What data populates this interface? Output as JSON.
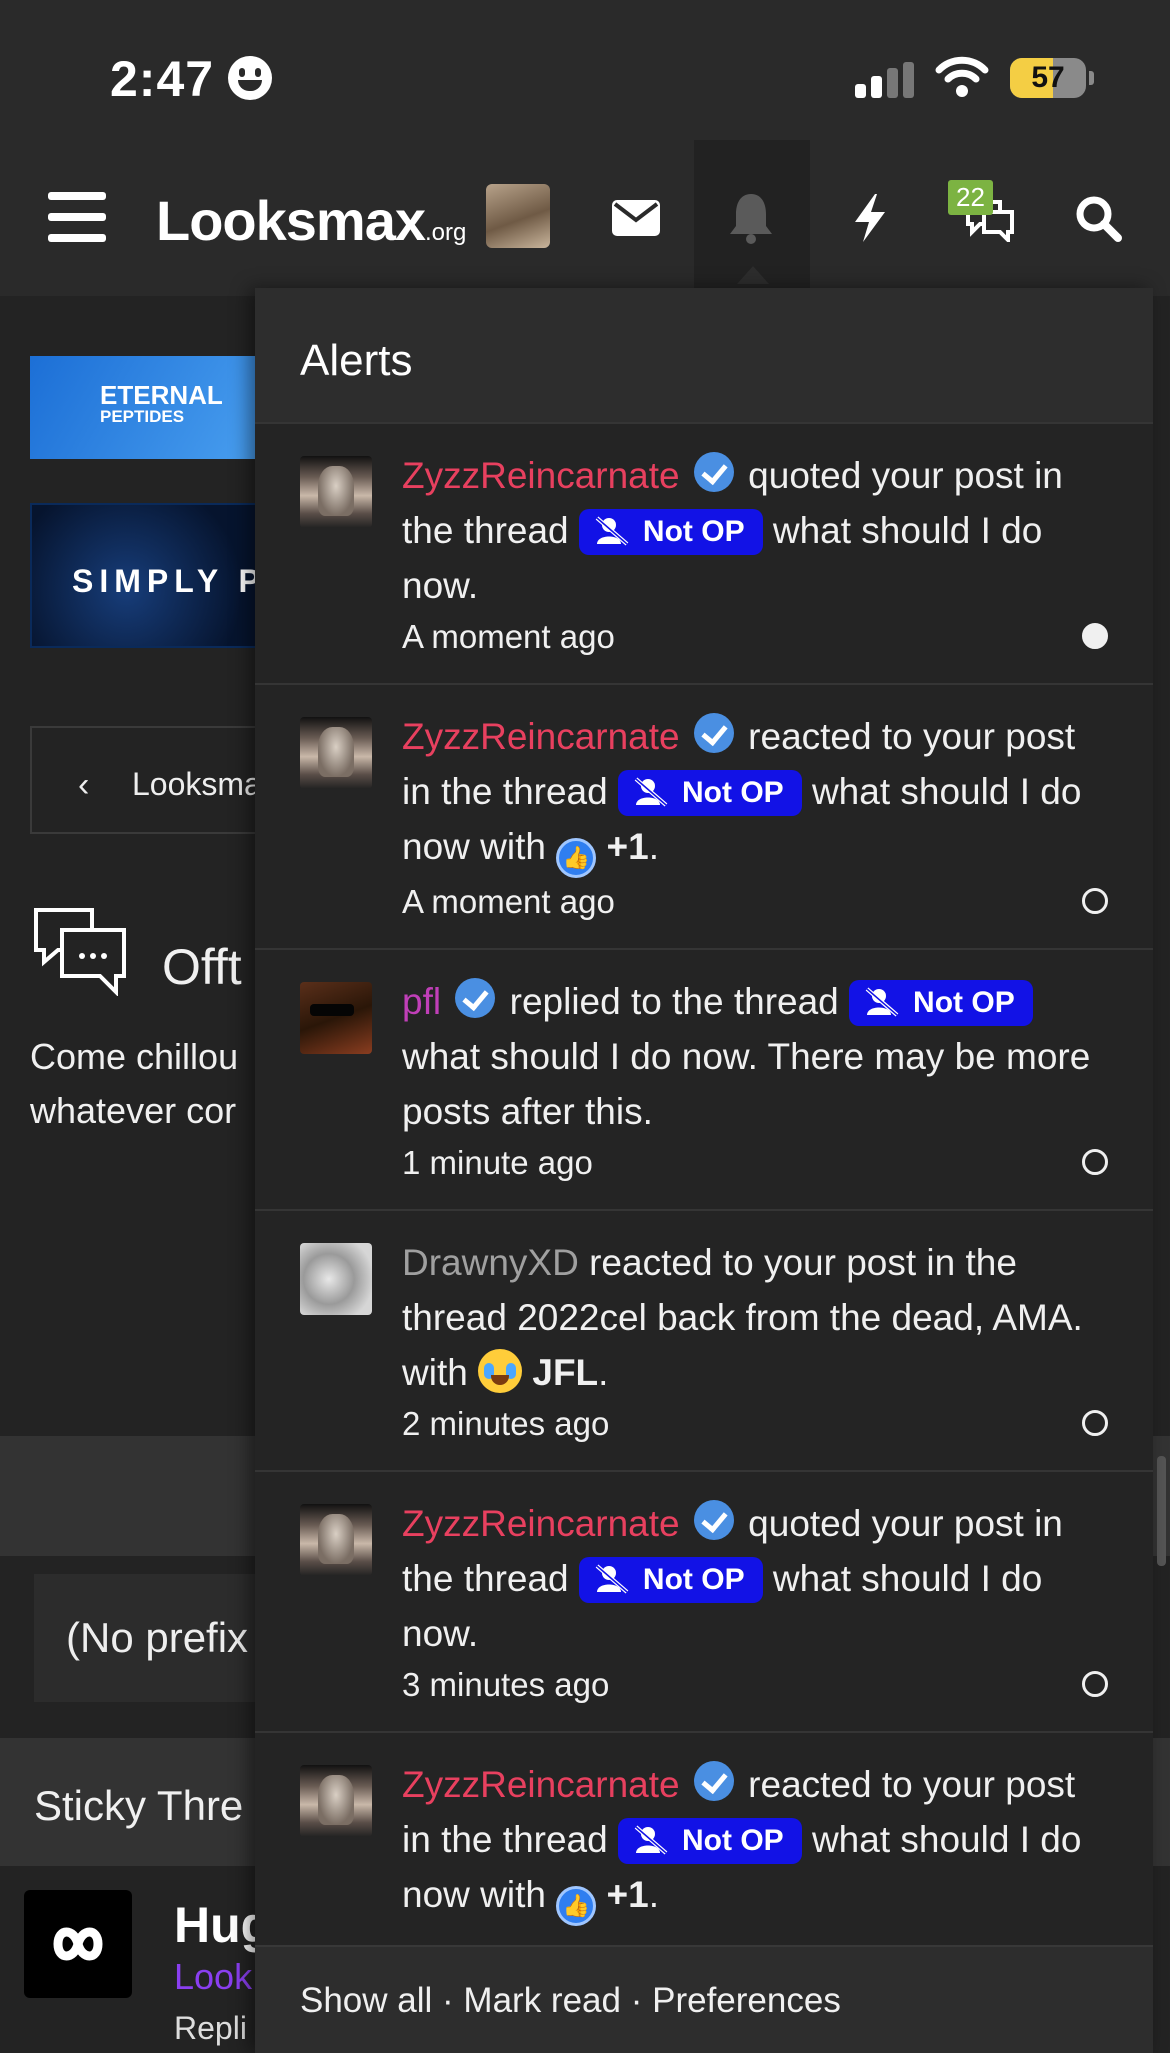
{
  "status_bar": {
    "time": "2:47",
    "battery": "57",
    "battery_level": 0.57
  },
  "nav": {
    "logo_main": "Looksmax",
    "logo_suffix": ".org",
    "conversations_count": "22",
    "icons": [
      "menu-icon",
      "avatar",
      "envelope-icon",
      "bell-icon",
      "bolt-icon",
      "chat-bubbles-icon",
      "search-icon"
    ]
  },
  "background_page": {
    "ad1_title": "ETERNAL",
    "ad1_sub": "PEPTIDES",
    "ad2_title": "SIMPLY P",
    "breadcrumb": "Looksma",
    "forum_title": "Offt",
    "forum_desc": "Come chillou\nwhatever cor",
    "prefix_filter": "(No prefix",
    "sticky_label": "Sticky Thre",
    "thread_title": "Hug",
    "thread_category": "Look",
    "thread_replies": "Repli"
  },
  "alerts_popup": {
    "title": "Alerts",
    "tag_label": "Not OP",
    "alerts": [
      {
        "user": "ZyzzReincarnate",
        "verified": true,
        "action": "quoted your post in the thread",
        "thread": "what should I do now.",
        "time": "A moment ago",
        "unread": true
      },
      {
        "user": "ZyzzReincarnate",
        "verified": true,
        "action": "reacted to your post in the thread",
        "thread": "what should I do now with",
        "reaction": "+1",
        "time": "A moment ago",
        "unread": false
      },
      {
        "user": "pfl",
        "verified": true,
        "action": "replied to the thread",
        "thread": "what should I do now. There may be more posts after this.",
        "time": "1 minute ago",
        "unread": false
      },
      {
        "user": "DrawnyXD",
        "verified": false,
        "action": "reacted to your post in the thread 2022cel back from the dead, AMA. with",
        "reaction": "JFL",
        "time": "2 minutes ago",
        "unread": false
      },
      {
        "user": "ZyzzReincarnate",
        "verified": true,
        "action": "quoted your post in the thread",
        "thread": "what should I do now.",
        "time": "3 minutes ago",
        "unread": false
      },
      {
        "user": "ZyzzReincarnate",
        "verified": true,
        "action": "reacted to your post in the thread",
        "thread": "what should I do now with",
        "reaction": "+1",
        "time": "",
        "unread": false
      }
    ],
    "footer": {
      "show_all": "Show all",
      "mark_read": "Mark read",
      "preferences": "Preferences",
      "separator": "·"
    }
  }
}
